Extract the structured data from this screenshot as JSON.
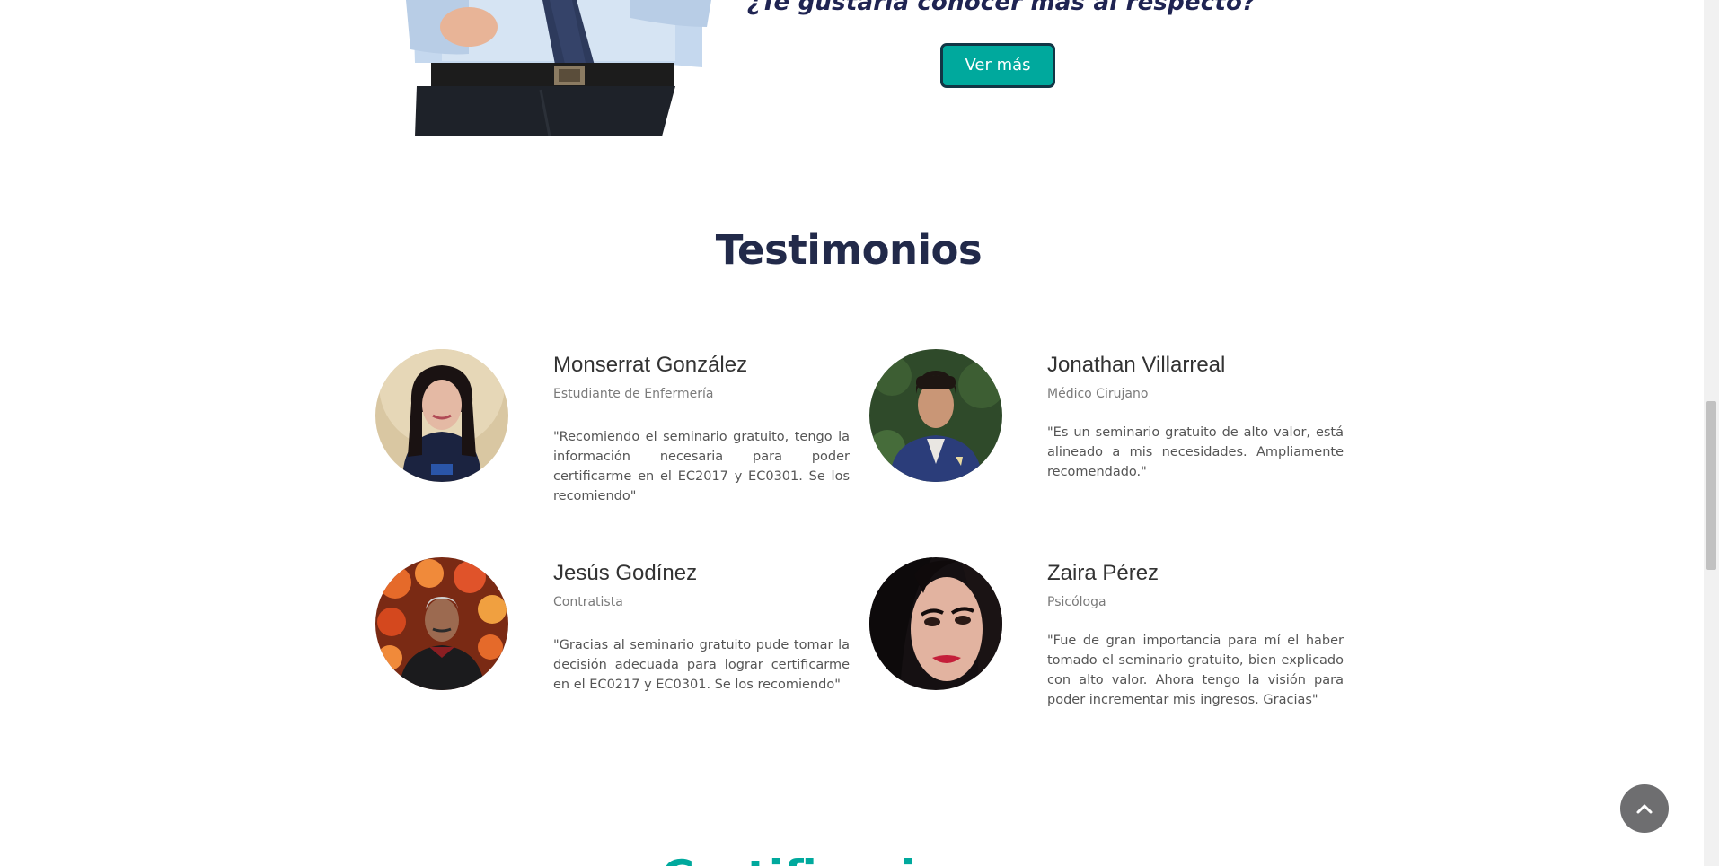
{
  "cta": {
    "question": "¿Te gustaría conocer más al respecto?",
    "button_label": "Ver más"
  },
  "testimonials": {
    "title": "Testimonios",
    "items": [
      {
        "name": "Monserrat González",
        "role": "Estudiante de Enfermería",
        "quote": "\"Recomiendo el seminario gratuito, tengo la información necesaria para poder certificarme en el EC2017 y EC0301. Se los recomiendo\""
      },
      {
        "name": "Jonathan Villarreal",
        "role": "Médico Cirujano",
        "quote": "\"Es un seminario gratuito de alto valor, está alineado a mis necesidades. Ampliamente recomendado.\""
      },
      {
        "name": "Jesús Godínez",
        "role": "Contratista",
        "quote": "\"Gracias al seminario gratuito pude tomar la decisión adecuada para lograr certificarme en el EC0217 y EC0301. Se los recomiendo\""
      },
      {
        "name": "Zaira Pérez",
        "role": "Psicóloga",
        "quote": "\"Fue de gran importancia para mí el haber tomado el seminario gratuito, bien explicado con alto valor. Ahora tengo la visión para poder incrementar mis ingresos. Gracias\""
      }
    ]
  },
  "next_section": {
    "title": "Certificaciones"
  },
  "icons": {
    "scroll_top": "chevron-up-icon"
  },
  "colors": {
    "accent": "#00a99d",
    "title": "#222a4a",
    "button_border": "#123645"
  }
}
